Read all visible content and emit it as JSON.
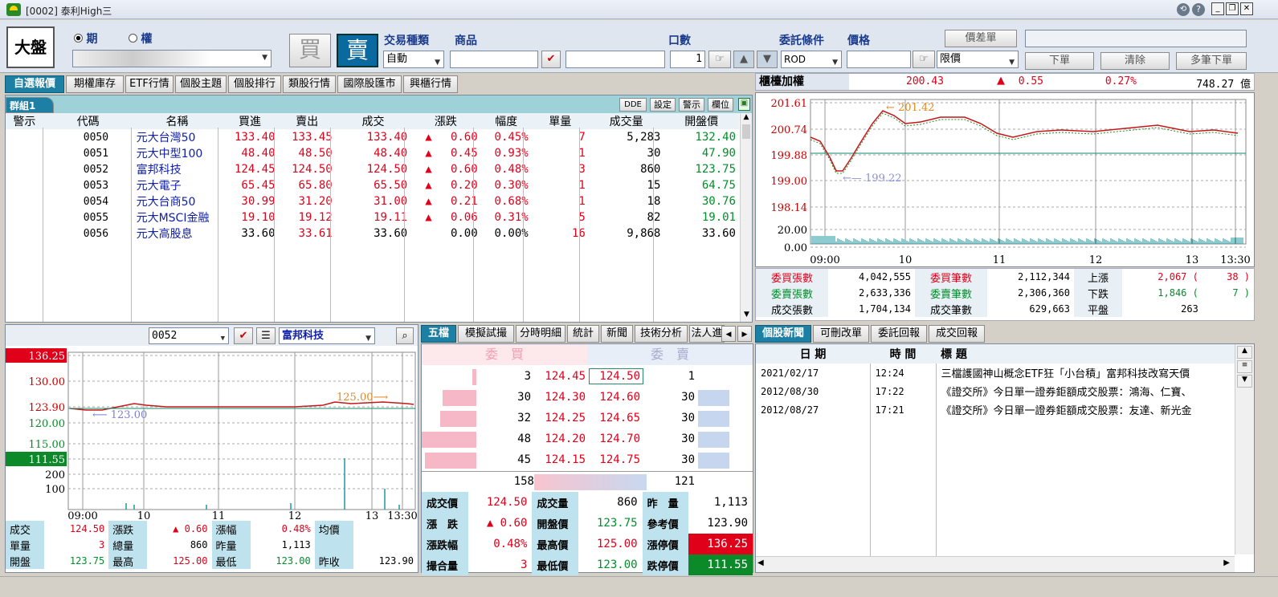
{
  "window": {
    "title": "[0002] 泰利High三"
  },
  "toolbar": {
    "dapan": "大盤",
    "radio_futures": "期",
    "radio_options": "權",
    "buy": "買",
    "sell": "賣",
    "trade_type_label": "交易種類",
    "product_label": "商品",
    "qty_label": "口數",
    "cond_label": "委託條件",
    "price_label": "價格",
    "trade_type_value": "自動",
    "qty_value": "1",
    "cond_value": "ROD",
    "price_type_value": "限價",
    "spread_btn": "價差單",
    "order_btn": "下單",
    "clear_btn": "清除",
    "multi_btn": "多筆下單"
  },
  "tabs": [
    "自選報價",
    "期權庫存",
    "ETF行情",
    "個股主題",
    "個股排行",
    "類股行情",
    "國際股匯市",
    "興櫃行情"
  ],
  "group": {
    "name": "群組1",
    "buttons": [
      "DDE",
      "設定",
      "警示",
      "欄位"
    ]
  },
  "watchlist": {
    "headers": [
      "警示",
      "代碼",
      "名稱",
      "買進",
      "賣出",
      "成交",
      "漲跌",
      "幅度",
      "單量",
      "成交量",
      "開盤價"
    ],
    "rows": [
      {
        "code": "0050",
        "name": "元大台灣50",
        "bid": "133.40",
        "ask": "133.45",
        "last": "133.40",
        "arrow": "▲",
        "chg": "0.60",
        "pct": "0.45%",
        "vol1": "7",
        "vol": "5,283",
        "open": "132.40",
        "dir": "up",
        "ocolor": "grn"
      },
      {
        "code": "0051",
        "name": "元大中型100",
        "bid": "48.40",
        "ask": "48.50",
        "last": "48.40",
        "arrow": "▲",
        "chg": "0.45",
        "pct": "0.93%",
        "vol1": "1",
        "vol": "30",
        "open": "47.90",
        "dir": "up",
        "ocolor": "grn"
      },
      {
        "code": "0052",
        "name": "富邦科技",
        "bid": "124.45",
        "ask": "124.50",
        "last": "124.50",
        "arrow": "▲",
        "chg": "0.60",
        "pct": "0.48%",
        "vol1": "3",
        "vol": "860",
        "open": "123.75",
        "dir": "up",
        "ocolor": "grn"
      },
      {
        "code": "0053",
        "name": "元大電子",
        "bid": "65.45",
        "ask": "65.80",
        "last": "65.50",
        "arrow": "▲",
        "chg": "0.20",
        "pct": "0.30%",
        "vol1": "1",
        "vol": "15",
        "open": "64.75",
        "dir": "up",
        "ocolor": "grn"
      },
      {
        "code": "0054",
        "name": "元大台商50",
        "bid": "30.99",
        "ask": "31.20",
        "last": "31.00",
        "arrow": "▲",
        "chg": "0.21",
        "pct": "0.68%",
        "vol1": "1",
        "vol": "18",
        "open": "30.76",
        "dir": "up",
        "ocolor": "grn"
      },
      {
        "code": "0055",
        "name": "元大MSCI金融",
        "bid": "19.10",
        "ask": "19.12",
        "last": "19.11",
        "arrow": "▲",
        "chg": "0.06",
        "pct": "0.31%",
        "vol1": "5",
        "vol": "82",
        "open": "19.01",
        "dir": "up",
        "ocolor": "grn"
      },
      {
        "code": "0056",
        "name": "元大高股息",
        "bid": "33.60",
        "ask": "33.61",
        "last": "33.60",
        "arrow": "",
        "chg": "0.00",
        "pct": "0.00%",
        "vol1": "16",
        "vol": "9,868",
        "open": "33.60",
        "dir": "flat",
        "ocolor": "blk"
      }
    ]
  },
  "index": {
    "name": "櫃檯加權",
    "value": "200.43",
    "arrow": "▲",
    "chg": "0.55",
    "pct": "0.27%",
    "amount": "748.27 億"
  },
  "index_chart": {
    "yticks": [
      "201.61",
      "200.74",
      "199.88",
      "199.00",
      "198.14",
      "20.00",
      "0.00"
    ],
    "xticks": [
      "09:00",
      "10",
      "11",
      "12",
      "13",
      "13:30"
    ],
    "high_label": "201.42",
    "low_label": "199.22"
  },
  "index_stats": {
    "rows": [
      [
        "委買張數",
        "4,042,555",
        "委買筆數",
        "2,112,344",
        "上漲",
        "2,067 (",
        "38 )"
      ],
      [
        "委賣張數",
        "2,633,336",
        "委賣筆數",
        "2,306,360",
        "下跌",
        "1,846 (",
        "7 )"
      ],
      [
        "成交張數",
        "1,704,134",
        "成交筆數",
        "629,663",
        "平盤",
        "263",
        ""
      ]
    ]
  },
  "stock": {
    "code": "0052",
    "name": "富邦科技",
    "yticks": [
      "136.25",
      "130.00",
      "123.90",
      "120.00",
      "115.00",
      "111.55",
      "200",
      "100"
    ],
    "xticks": [
      "09:00",
      "10",
      "11",
      "12",
      "13",
      "13:30"
    ],
    "high_label": "125.00",
    "low_label": "123.00",
    "stats": [
      [
        "成交",
        "124.50",
        "漲跌",
        "▲ 0.60",
        "漲幅",
        "0.48%",
        "均價",
        ""
      ],
      [
        "單量",
        "3",
        "總量",
        "860",
        "昨量",
        "1,113",
        "",
        ""
      ],
      [
        "開盤",
        "123.75",
        "最高",
        "125.00",
        "最低",
        "123.00",
        "昨收",
        "123.90"
      ]
    ]
  },
  "quote_tabs": [
    "五檔",
    "模擬試撮",
    "分時明細",
    "統計",
    "新聞",
    "技術分析",
    "法人進"
  ],
  "five": {
    "bid_label": "委　買",
    "ask_label": "委　賣",
    "rows": [
      {
        "bq": "3",
        "bp": "124.45",
        "ap": "124.50",
        "aq": "1",
        "bw": 0.07,
        "aw": 0
      },
      {
        "bq": "30",
        "bp": "124.30",
        "ap": "124.60",
        "aq": "30",
        "bw": 0.62,
        "aw": 0.92
      },
      {
        "bq": "32",
        "bp": "124.25",
        "ap": "124.65",
        "aq": "30",
        "bw": 0.66,
        "aw": 0.92
      },
      {
        "bq": "48",
        "bp": "124.20",
        "ap": "124.70",
        "aq": "30",
        "bw": 1.0,
        "aw": 0.92
      },
      {
        "bq": "45",
        "bp": "124.15",
        "ap": "124.75",
        "aq": "30",
        "bw": 0.94,
        "aw": 0.92
      }
    ],
    "bid_total": "158",
    "ask_total": "121",
    "info": [
      [
        "成交價",
        "124.50",
        "成交量",
        "860",
        "昨　量",
        "1,113"
      ],
      [
        "漲　跌",
        "▲ 0.60",
        "開盤價",
        "123.75",
        "參考價",
        "123.90"
      ],
      [
        "漲跌幅",
        "0.48%",
        "最高價",
        "125.00",
        "漲停價",
        "136.25"
      ],
      [
        "撮合量",
        "3",
        "最低價",
        "123.00",
        "跌停價",
        "111.55"
      ]
    ]
  },
  "news_tabs": [
    "個股新聞",
    "可刪改單",
    "委託回報",
    "成交回報"
  ],
  "news": {
    "headers": [
      "日 期",
      "時 間",
      "標 題"
    ],
    "rows": [
      [
        "2021/02/17",
        "12:24",
        "三檔護國神山概念ETF狂「小台積」富邦科技改寫天價"
      ],
      [
        "2012/08/30",
        "17:22",
        "《證交所》今日單一證券鉅額成交股票：鴻海、仁寶、"
      ],
      [
        "2012/08/27",
        "17:21",
        "《證交所》今日單一證券鉅額成交股票：友達、新光金"
      ]
    ]
  },
  "colors": {
    "up": "#e0001a",
    "down": "#008f2a",
    "accent": "#1c7fa3"
  }
}
